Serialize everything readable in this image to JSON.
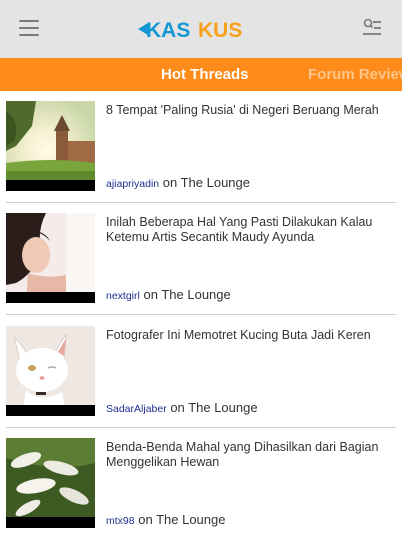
{
  "header": {
    "logo_text_part1": "KAS",
    "logo_text_part2": "KUS",
    "colors": {
      "background": "#e4e4e4",
      "logo_blue": "#1498d5",
      "logo_orange": "#f7a11a",
      "icon_gray": "#7a7a7a"
    }
  },
  "tabs": [
    {
      "label": "Hot Threads",
      "active": true
    },
    {
      "label": "Forum Review",
      "active": false
    }
  ],
  "tab_bar_color": "#ff8c1a",
  "threads": [
    {
      "title": "8 Tempat 'Paling Rusia' di Negeri Beruang Merah",
      "user": "ajiapriyadin",
      "on": "on",
      "forum": "The Lounge",
      "thumb": "castle-photo"
    },
    {
      "title": "Inilah Beberapa Hal Yang Pasti Dilakukan Kalau Ketemu Artis Secantik Maudy Ayunda",
      "user": "nextgirl",
      "on": "on",
      "forum": "The Lounge",
      "thumb": "woman-photo"
    },
    {
      "title": "Fotografer Ini Memotret Kucing Buta Jadi Keren",
      "user": "SadarAljaber",
      "on": "on",
      "forum": "The Lounge",
      "thumb": "cat-photo"
    },
    {
      "title": "Benda-Benda Mahal yang Dihasilkan dari Bagian Menggelikan Hewan",
      "user": "mtx98",
      "on": "on",
      "forum": "The Lounge",
      "thumb": "silkworm-photo"
    }
  ]
}
